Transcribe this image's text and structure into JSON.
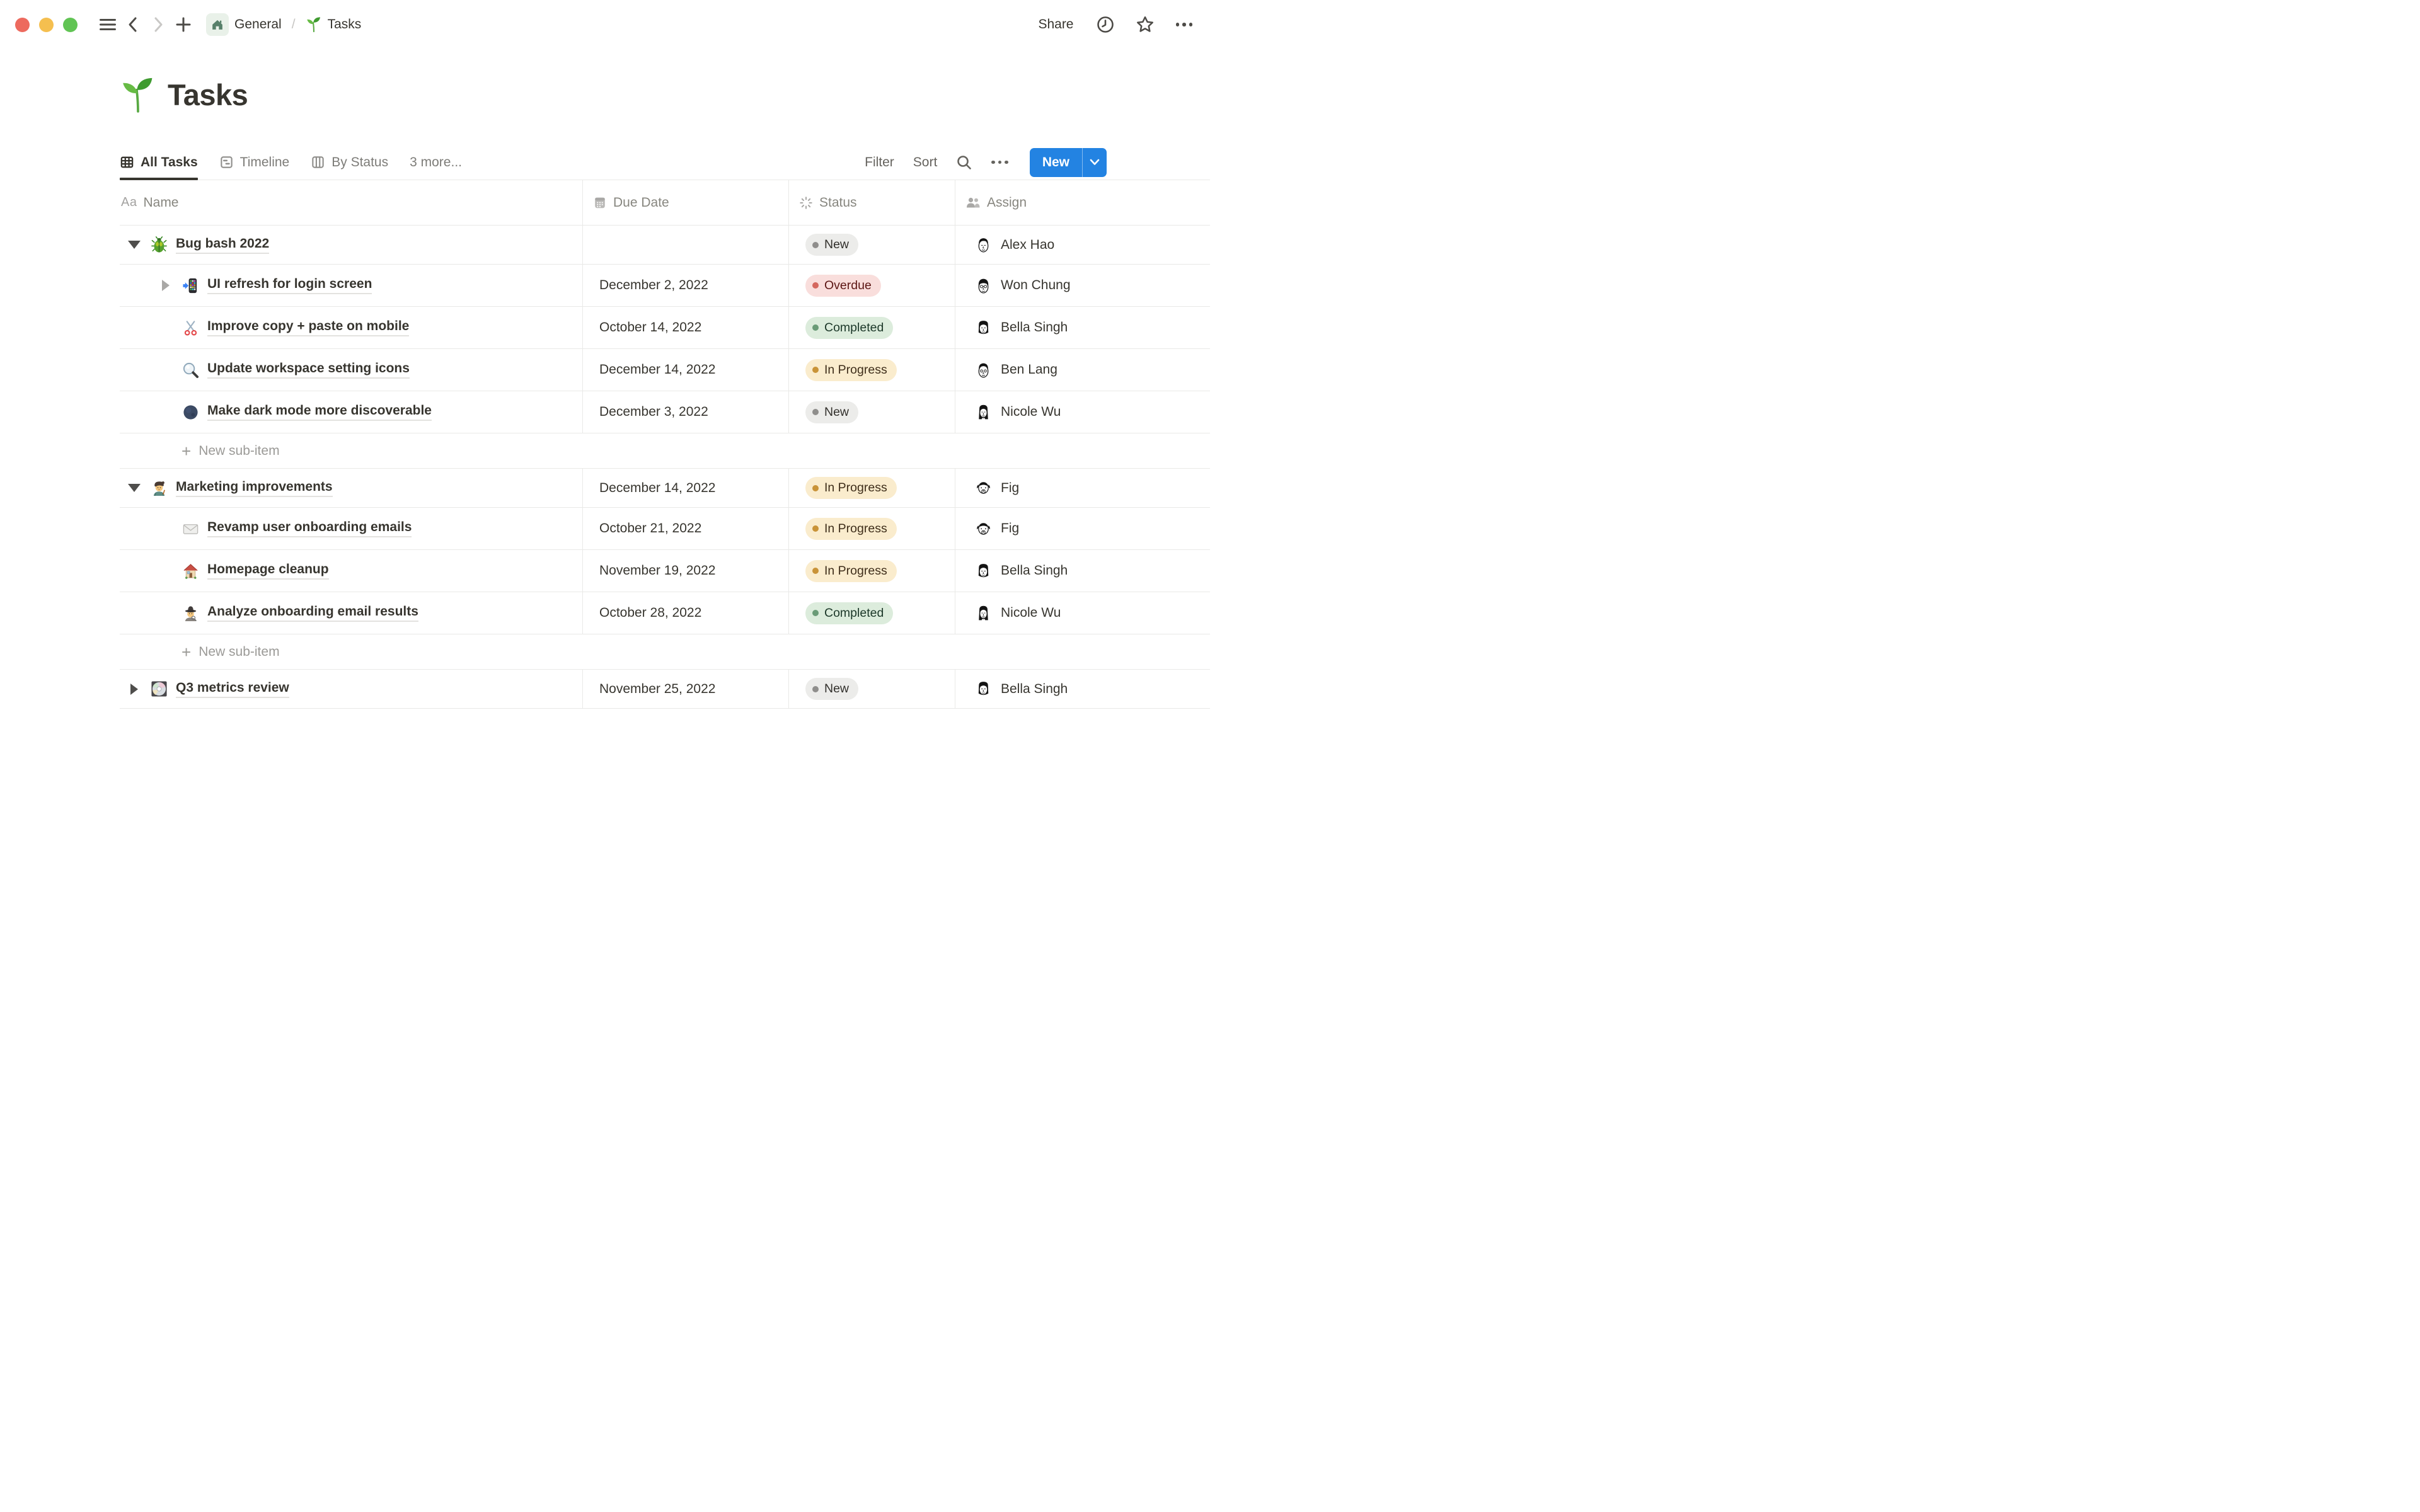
{
  "window": {
    "traffic_lights": [
      "close",
      "minimize",
      "zoom"
    ]
  },
  "toolbar": {
    "breadcrumb": {
      "home_label": "General",
      "separator": "/",
      "page_label": "Tasks"
    },
    "share_label": "Share"
  },
  "page": {
    "icon": "seedling",
    "title": "Tasks"
  },
  "views": {
    "tabs": [
      {
        "label": "All Tasks",
        "icon": "table",
        "active": true
      },
      {
        "label": "Timeline",
        "icon": "timeline",
        "active": false
      },
      {
        "label": "By Status",
        "icon": "board",
        "active": false
      },
      {
        "label": "3 more...",
        "active": false
      }
    ],
    "controls": {
      "filter": "Filter",
      "sort": "Sort",
      "more_icon": "ellipsis",
      "search_icon": "magnifier",
      "new_label": "New"
    }
  },
  "table": {
    "columns": [
      {
        "icon_label": "Aa",
        "label": "Name"
      },
      {
        "icon": "calendar",
        "label": "Due Date"
      },
      {
        "icon": "status-burst",
        "label": "Status"
      },
      {
        "icon": "people",
        "label": "Assign"
      }
    ],
    "rows": [
      {
        "name": "Bug bash 2022",
        "icon": "beetle",
        "level": 0,
        "toggle": "expanded",
        "due": "",
        "status": "New",
        "assignee": "Alex Hao"
      },
      {
        "name": "UI refresh for login screen",
        "icon": "phone-arrow",
        "level": 1,
        "toggle": "collapsed",
        "due": "December 2, 2022",
        "status": "Overdue",
        "assignee": "Won Chung"
      },
      {
        "name": "Improve copy + paste on mobile",
        "icon": "scissors",
        "level": 1,
        "due": "October 14, 2022",
        "status": "Completed",
        "assignee": "Bella Singh"
      },
      {
        "name": "Update workspace setting icons",
        "icon": "magnifier",
        "level": 1,
        "due": "December 14, 2022",
        "status": "In Progress",
        "assignee": "Ben Lang"
      },
      {
        "name": "Make dark mode more discoverable",
        "icon": "new-moon",
        "level": 1,
        "due": "December 3, 2022",
        "status": "New",
        "assignee": "Nicole Wu"
      },
      {
        "type": "new-sub-item",
        "label": "New sub-item"
      },
      {
        "name": "Marketing improvements",
        "icon": "artist",
        "level": 0,
        "toggle": "expanded",
        "due": "December 14, 2022",
        "status": "In Progress",
        "assignee": "Fig"
      },
      {
        "name": "Revamp user onboarding emails",
        "icon": "envelope",
        "level": 1,
        "due": "October 21, 2022",
        "status": "In Progress",
        "assignee": "Fig"
      },
      {
        "name": "Homepage cleanup",
        "icon": "house",
        "level": 1,
        "due": "November 19, 2022",
        "status": "In Progress",
        "assignee": "Bella Singh"
      },
      {
        "name": "Analyze onboarding email results",
        "icon": "detective",
        "level": 1,
        "due": "October 28, 2022",
        "status": "Completed",
        "assignee": "Nicole Wu"
      },
      {
        "type": "new-sub-item",
        "label": "New sub-item"
      },
      {
        "name": "Q3 metrics review",
        "icon": "cd",
        "level": 0,
        "toggle": "collapsed",
        "due": "November 25, 2022",
        "status": "New",
        "assignee": "Bella Singh"
      }
    ]
  },
  "colors": {
    "accent_blue": "#2383e2",
    "traffic_red": "#ed6a5e",
    "traffic_yellow": "#f5bf4f",
    "traffic_green": "#61c454",
    "status_new_bg": "#ececea",
    "status_new_dot": "#8f8e8c",
    "status_new_text": "#32302c",
    "status_overdue_bg": "#f9dedc",
    "status_overdue_dot": "#d4675e",
    "status_overdue_text": "#5d1715",
    "status_completed_bg": "#dcecdc",
    "status_completed_dot": "#6a9b77",
    "status_completed_text": "#1c3829",
    "status_inprogress_bg": "#faeccd",
    "status_inprogress_dot": "#c99338",
    "status_inprogress_text": "#3f2e1a",
    "divider": "#e9e9e7",
    "text_dark": "#37352f",
    "text_gray": "#87867f"
  }
}
